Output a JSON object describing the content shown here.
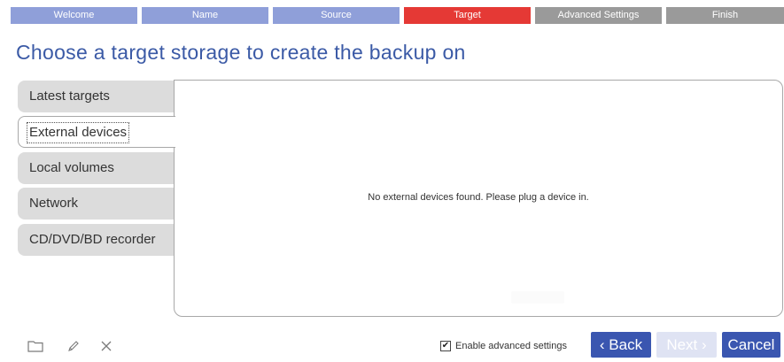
{
  "wizard": {
    "steps": [
      {
        "label": "Welcome",
        "color": "#8f9fd9"
      },
      {
        "label": "Name",
        "color": "#8f9fd9"
      },
      {
        "label": "Source",
        "color": "#8f9fd9"
      },
      {
        "label": "Target",
        "color": "#e53935"
      },
      {
        "label": "Advanced Settings",
        "color": "#9a9a9a"
      },
      {
        "label": "Finish",
        "color": "#9a9a9a"
      }
    ],
    "current_step": "Target"
  },
  "page": {
    "title": "Choose a target storage to create the backup on"
  },
  "tabs": [
    {
      "label": "Latest targets",
      "active": false
    },
    {
      "label": "External devices",
      "active": true
    },
    {
      "label": "Local volumes",
      "active": false
    },
    {
      "label": "Network",
      "active": false
    },
    {
      "label": "CD/DVD/BD recorder",
      "active": false
    }
  ],
  "panel": {
    "message": "No external devices found. Please plug a device in."
  },
  "toolbar": {
    "icons": [
      "folder-icon",
      "pencil-icon",
      "close-icon"
    ]
  },
  "footer": {
    "advanced_checkbox_label": "Enable advanced settings",
    "advanced_checked": true,
    "back_label": "‹ Back",
    "next_label": "Next ›",
    "cancel_label": "Cancel",
    "colors": {
      "primary": "#3a56b0",
      "disabled": "#dfe3f3"
    }
  }
}
